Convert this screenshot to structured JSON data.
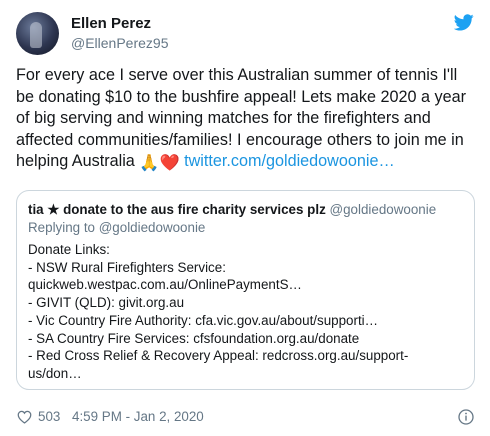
{
  "author": {
    "name": "Ellen Perez",
    "handle": "@EllenPerez95"
  },
  "tweet": {
    "lines": [
      "For every ace I serve over this Australian summer of tennis I'll",
      "be donating $10 to the bushfire appeal! Lets make 2020 a year",
      "of big serving and winning matches for the firefighters and",
      "affected communities/families! I encourage others to join me in",
      "helping Australia"
    ],
    "emoji": [
      "🙏",
      "❤️"
    ],
    "link": "twitter.com/goldiedowoonie…"
  },
  "quoted": {
    "name": "tia ★ donate to the aus fire charity services plz",
    "handle": "@goldiedowoonie",
    "replying_to": "Replying to @goldiedowoonie",
    "lines": [
      "Donate Links:",
      "- NSW Rural Firefighters Service:",
      "quickweb.westpac.com.au/OnlinePaymentS…",
      "- GIVIT (QLD): givit.org.au",
      "- Vic Country Fire Authority: cfa.vic.gov.au/about/supporti…",
      "- SA Country Fire Services:  cfsfoundation.org.au/donate",
      "- Red Cross Relief & Recovery Appeal: redcross.org.au/support-",
      "us/don…"
    ]
  },
  "footer": {
    "likes": "503",
    "timestamp": "4:59 PM - Jan 2, 2020"
  },
  "icons": {
    "brand": "twitter-bird-icon",
    "like": "heart-outline-icon",
    "info": "info-circle-icon"
  },
  "colors": {
    "link": "#1b95e0",
    "twitter_blue": "#1da1f2",
    "secondary_text": "#657786",
    "border": "#ccd6dd",
    "heart_emoji": "#dd2e44"
  }
}
